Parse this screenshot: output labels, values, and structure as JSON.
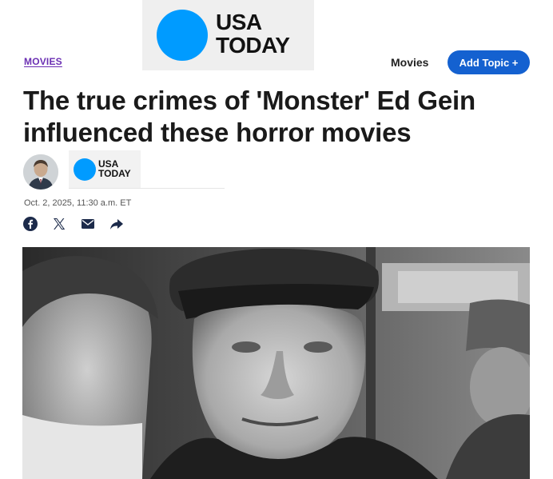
{
  "masthead": {
    "line1": "USA",
    "line2": "TODAY"
  },
  "section": {
    "label": "MOVIES"
  },
  "topic": {
    "label": "Movies",
    "add_button": "Add Topic +"
  },
  "article": {
    "headline": "The true crimes of 'Monster' Ed Gein influenced these horror movies",
    "publisher": {
      "line1": "USA",
      "line2": "TODAY"
    },
    "date": "Oct. 2, 2025, 11:30 a.m. ET"
  },
  "share": {
    "icons": [
      "facebook-icon",
      "x-icon",
      "email-icon",
      "share-arrow-icon"
    ]
  },
  "colors": {
    "brand_blue": "#009bff",
    "section_purple": "#6b2fb3",
    "button_blue": "#1461d0"
  }
}
